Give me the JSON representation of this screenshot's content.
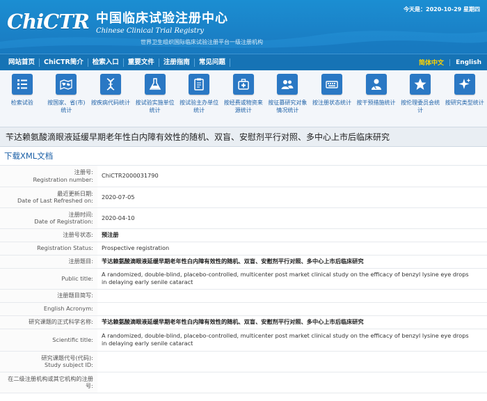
{
  "header": {
    "logo_mark": "ChiCTR",
    "title_cn": "中国临床试验注册中心",
    "title_en": "Chinese Clinical Trial Registry",
    "subtitle": "世界卫生组织国际临床试验注册平台一级注册机构",
    "date": "今天是：2020-10-29 星期四"
  },
  "nav": {
    "items": [
      "网站首页",
      "ChiCTR简介",
      "检索入口",
      "重要文件",
      "注册指南",
      "常见问题"
    ],
    "lang_cn": "简体中文",
    "lang_en": "English"
  },
  "icons": [
    {
      "icon": "list-icon",
      "label": "检索试验"
    },
    {
      "icon": "world-map-icon",
      "label": "按国家、省(市)统计"
    },
    {
      "icon": "dna-icon",
      "label": "按疾病代码统计"
    },
    {
      "icon": "flask-icon",
      "label": "按试验实施单位统计"
    },
    {
      "icon": "clipboard-icon",
      "label": "按试验主办单位统计"
    },
    {
      "icon": "medical-kit-icon",
      "label": "按经费或物资来源统计"
    },
    {
      "icon": "people-icon",
      "label": "按征募研究对象情况统计"
    },
    {
      "icon": "keyboard-icon",
      "label": "按注册状态统计"
    },
    {
      "icon": "doctor-icon",
      "label": "按干预措施统计"
    },
    {
      "icon": "star-icon",
      "label": "按伦理委员会统计"
    },
    {
      "icon": "sparkle-icon",
      "label": "按研究类型统计"
    }
  ],
  "page_title": "苄达赖氨酸滴眼液延缓早期老年性白内障有效性的随机、双盲、安慰剂平行对照、多中心上市后临床研究",
  "download_label": "下载XML文档",
  "fields": [
    {
      "label_cn": "注册号:",
      "label_en": "Registration number:",
      "value": "ChiCTR2000031790"
    },
    {
      "label_cn": "最近更新日期:",
      "label_en": "Date of Last Refreshed on:",
      "value": "2020-07-05"
    },
    {
      "label_cn": "注册时间:",
      "label_en": "Date of Registration:",
      "value": "2020-04-10"
    },
    {
      "label_cn": "注册号状态:",
      "value": "预注册",
      "cn": true
    },
    {
      "label_cn": "Registration Status:",
      "value": "Prospective registration"
    },
    {
      "label_cn": "注册题目:",
      "value": "苄达赖氨酸滴眼液延缓早期老年性白内障有效性的随机、双盲、安慰剂平行对照、多中心上市后临床研究",
      "cn": true
    },
    {
      "label_cn": "Public title:",
      "value": "A randomized, double-blind, placebo-controlled, multicenter post market clinical study on the efficacy of benzyl lysine eye drops in delaying early senile cataract"
    },
    {
      "label_cn": "注册题目简写:",
      "value": ""
    },
    {
      "label_cn": "English Acronym:",
      "value": ""
    },
    {
      "label_cn": "研究课题的正式科学名称:",
      "value": "苄达赖氨酸滴眼液延缓早期老年性白内障有效性的随机、双盲、安慰剂平行对照、多中心上市后临床研究",
      "cn": true
    },
    {
      "label_cn": "Scientific title:",
      "value": "A randomized, double-blind, placebo-controlled, multicenter post market clinical study on the efficacy of benzyl lysine eye drops in delaying early senile cataract"
    },
    {
      "label_cn": "研究课题代号(代码):",
      "label_en": "Study subject ID:",
      "value": ""
    },
    {
      "label_cn": "在二级注册机构或其它机构的注册",
      "label_en": "号:",
      "value": ""
    }
  ]
}
